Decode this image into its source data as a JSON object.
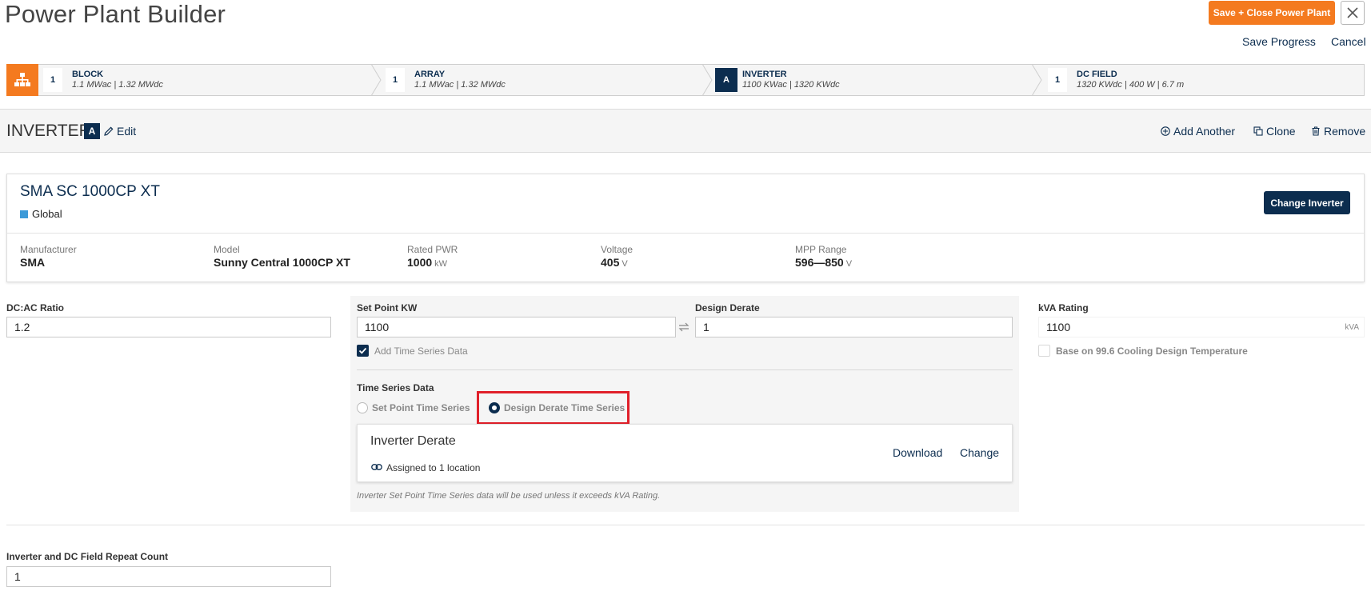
{
  "header": {
    "title": "Power Plant Builder",
    "save_close_label": "Save + Close Power Plant",
    "save_progress_label": "Save Progress",
    "cancel_label": "Cancel"
  },
  "breadcrumb": {
    "items": [
      {
        "num": "1",
        "name": "BLOCK",
        "detail": "1.1 MWac | 1.32 MWdc",
        "active": false
      },
      {
        "num": "1",
        "name": "ARRAY",
        "detail": "1.1 MWac | 1.32 MWdc",
        "active": false
      },
      {
        "num": "A",
        "name": "INVERTER",
        "detail": "1100 KWac | 1320 KWdc",
        "active": true
      },
      {
        "num": "1",
        "name": "DC FIELD",
        "detail": "1320 KWdc | 400 W | 6.7 m",
        "active": false
      }
    ]
  },
  "section": {
    "title": "INVERTER",
    "badge": "A",
    "edit_label": "Edit",
    "add_another_label": "Add Another",
    "clone_label": "Clone",
    "remove_label": "Remove"
  },
  "inverter": {
    "name": "SMA SC 1000CP XT",
    "scope": "Global",
    "change_label": "Change Inverter",
    "specs": {
      "manufacturer": {
        "label": "Manufacturer",
        "value": "SMA",
        "unit": ""
      },
      "model": {
        "label": "Model",
        "value": "Sunny Central 1000CP XT",
        "unit": ""
      },
      "rated_pwr": {
        "label": "Rated PWR",
        "value": "1000",
        "unit": "kW"
      },
      "voltage": {
        "label": "Voltage",
        "value": "405",
        "unit": "V"
      },
      "mpp_range": {
        "label": "MPP Range",
        "value": "596—850",
        "unit": "V"
      }
    }
  },
  "form": {
    "dc_ac_ratio": {
      "label": "DC:AC Ratio",
      "value": "1.2"
    },
    "set_point_kw": {
      "label": "Set Point KW",
      "value": "1100"
    },
    "design_derate": {
      "label": "Design Derate",
      "value": "1"
    },
    "add_time_series": {
      "label": "Add Time Series Data",
      "checked": true
    },
    "time_series": {
      "label": "Time Series Data",
      "option_set_point": "Set Point Time Series",
      "option_design_derate": "Design Derate Time Series",
      "selected": "design_derate"
    },
    "derate_card": {
      "title": "Inverter Derate",
      "assigned": "Assigned to 1 location",
      "download_label": "Download",
      "change_label": "Change"
    },
    "note": "Inverter Set Point Time Series data will be used unless it exceeds kVA Rating.",
    "kva_rating": {
      "label": "kVA Rating",
      "value": "1100",
      "unit": "kVA"
    },
    "cooling_temp": {
      "label": "Base on 99.6 Cooling Design Temperature",
      "checked": false
    },
    "repeat_count": {
      "label": "Inverter and DC Field Repeat Count",
      "value": "1"
    }
  },
  "colors": {
    "accent_orange": "#f47a1f",
    "navy": "#0c2d4f",
    "highlight_red": "#e0202a",
    "global_blue": "#3c9ad8"
  }
}
